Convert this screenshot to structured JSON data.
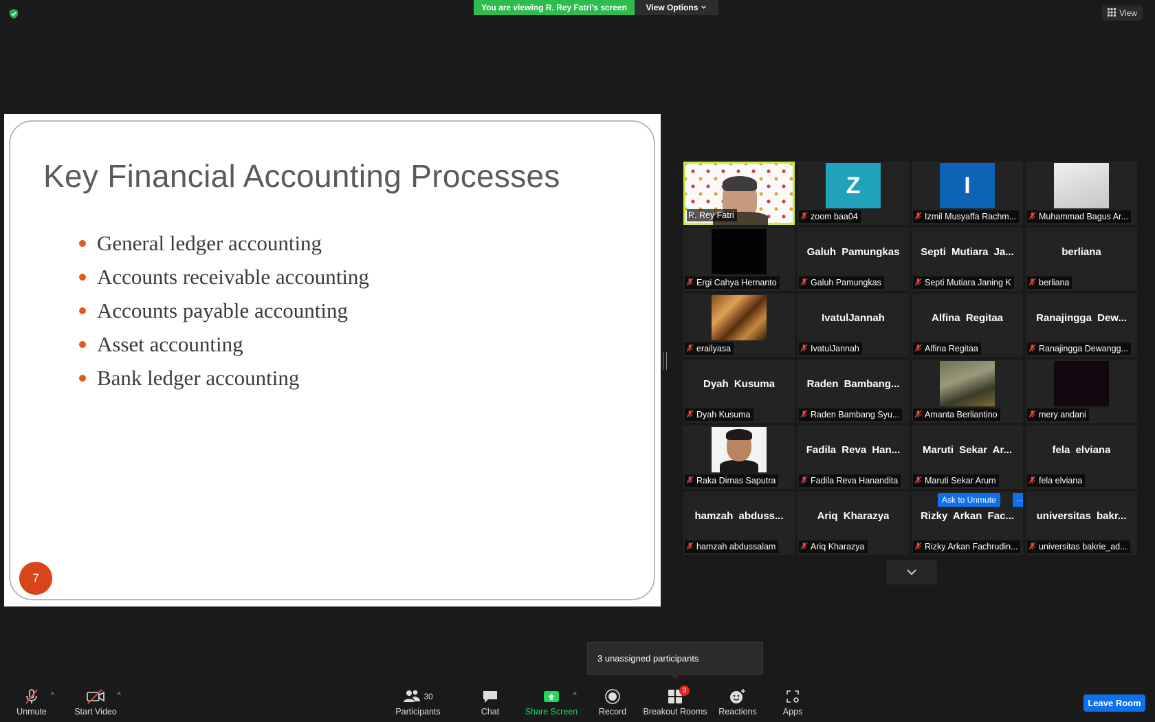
{
  "top_bar": {
    "viewing_banner": "You are viewing R. Rey Fatri's screen",
    "view_options": "View Options",
    "view_button": "View",
    "banner_color": "#2ebc4f"
  },
  "slide": {
    "title": "Key Financial Accounting Processes",
    "bullets": [
      "General ledger accounting",
      "Accounts receivable accounting",
      "Accounts payable accounting",
      "Asset accounting",
      "Bank ledger accounting"
    ],
    "page_number": "7",
    "bullet_color": "#e05a1e"
  },
  "gallery": {
    "tiles": [
      {
        "label": "R. Rey Fatri",
        "avatar": "host-video",
        "active": true
      },
      {
        "label": "zoom baa04",
        "avatar": "letter-z",
        "letter": "Z"
      },
      {
        "label": "Izmil Musyaffa Rachm...",
        "avatar": "letter-i",
        "letter": "I"
      },
      {
        "label": "Muhammad Bagus Ar...",
        "avatar": "photo-white"
      },
      {
        "label": "Ergi Cahya Hernanto",
        "avatar": "photo-black"
      },
      {
        "label": "Galuh Pamungkas",
        "display_name": "Galuh Pamungkas"
      },
      {
        "label": "Septi Mutiara Janing K",
        "display_name": "Septi Mutiara Ja..."
      },
      {
        "label": "berliana",
        "display_name": "berliana"
      },
      {
        "label": "erailyasa",
        "avatar": "photo-painting"
      },
      {
        "label": "IvatulJannah",
        "display_name": "IvatulJannah"
      },
      {
        "label": "Alfina Regitaa",
        "display_name": "Alfina Regitaa"
      },
      {
        "label": "Ranajingga Dewangg...",
        "display_name": "Ranajingga Dew..."
      },
      {
        "label": "Dyah Kusuma",
        "display_name": "Dyah Kusuma"
      },
      {
        "label": "Raden Bambang Syu...",
        "display_name": "Raden Bambang..."
      },
      {
        "label": "Amanta Berliantino",
        "avatar": "photo-jacket"
      },
      {
        "label": "mery andani",
        "avatar": "photo-dark"
      },
      {
        "label": "Raka Dimas Saputra",
        "avatar": "photo-face"
      },
      {
        "label": "Fadila Reva Hanandita",
        "display_name": "Fadila Reva Han..."
      },
      {
        "label": "Maruti Sekar Arum",
        "display_name": "Maruti Sekar Ar..."
      },
      {
        "label": "fela elviana",
        "display_name": "fela elviana"
      },
      {
        "label": "hamzah abdussalam",
        "display_name": "hamzah abduss..."
      },
      {
        "label": "Ariq Kharazya",
        "display_name": "Ariq Kharazya"
      },
      {
        "label": "Rizky Arkan Fachrudin...",
        "display_name": "Rizky Arkan Fac...",
        "ask_to_unmute": "Ask to Unmute",
        "more": "···"
      },
      {
        "label": "universitas bakrie_ad...",
        "display_name": "universitas bakr..."
      }
    ],
    "active_speaker_color": "#c6ee3f"
  },
  "tooltip": {
    "text": "3 unassigned participants"
  },
  "toolbar": {
    "unmute": "Unmute",
    "start_video": "Start Video",
    "participants": "Participants",
    "participants_count": "30",
    "chat": "Chat",
    "share_screen": "Share Screen",
    "record": "Record",
    "breakout_rooms": "Breakout Rooms",
    "breakout_badge": "3",
    "reactions": "Reactions",
    "apps": "Apps",
    "leave_room": "Leave Room",
    "share_color": "#23d959",
    "leave_color": "#0e71eb"
  }
}
